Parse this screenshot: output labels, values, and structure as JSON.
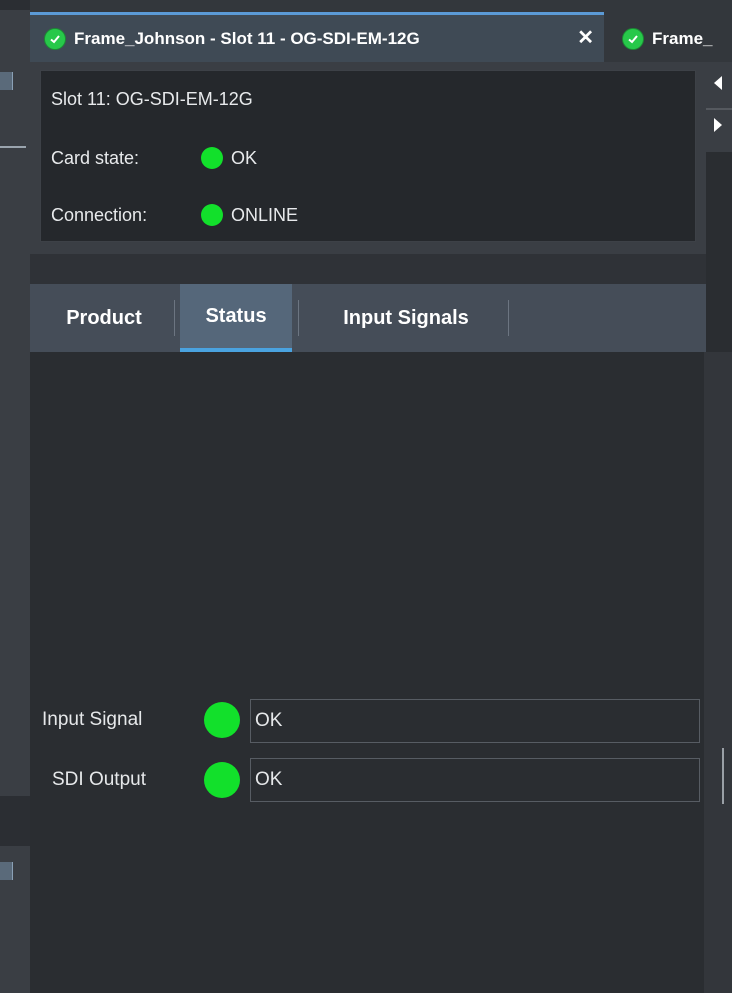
{
  "window": {
    "active_tab_title": "Frame_Johnson - Slot 11 - OG-SDI-EM-12G",
    "next_tab_title": "Frame_",
    "close_symbol": "✕"
  },
  "header": {
    "slot_title": "Slot 11: OG-SDI-EM-12G",
    "card_state_label": "Card state:",
    "card_state_value": "OK",
    "connection_label": "Connection:",
    "connection_value": "ONLINE"
  },
  "subtabs": [
    {
      "label": "Product",
      "active": false
    },
    {
      "label": "Status",
      "active": true
    },
    {
      "label": "Input Signals",
      "active": false
    }
  ],
  "status": {
    "rows": [
      {
        "label": "Input Signal",
        "value": "OK",
        "indicator": "green"
      },
      {
        "label": "SDI Output",
        "value": "OK",
        "indicator": "green"
      }
    ]
  },
  "colors": {
    "ok_green": "#12e02b",
    "accent_blue": "#4aa3e0",
    "background": "#2a2d31"
  },
  "icons": [
    "check-circle-icon",
    "close-icon",
    "arrow-left-icon",
    "arrow-right-icon",
    "status-led-icon"
  ]
}
